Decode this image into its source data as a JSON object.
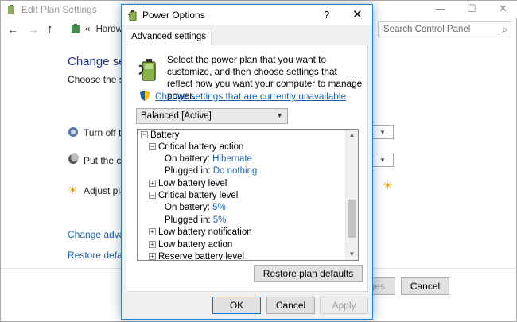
{
  "background": {
    "title": "Edit Plan Settings",
    "controls": {
      "minimize": "—",
      "maximize": "☐",
      "close": "✕"
    },
    "nav": {
      "back": "←",
      "forward": "→",
      "up": "↑",
      "chevrons": "«",
      "address": "Hardwa"
    },
    "search": {
      "placeholder": "Search Control Panel"
    },
    "heading": "Change setti",
    "subtext": "Choose the slee",
    "rows": [
      "Turn off the",
      "Put the con",
      "Adjust plan"
    ],
    "links": [
      "Change advance",
      "Restore default"
    ],
    "footer_buttons": {
      "save": "ges",
      "cancel": "Cancel"
    }
  },
  "dialog": {
    "title": "Power Options",
    "help": "?",
    "close": "✕",
    "tab": "Advanced settings",
    "intro": "Select the power plan that you want to customize, and then choose settings that reflect how you want your computer to manage power.",
    "change_link": "Change settings that are currently unavailable",
    "plan_select": "Balanced [Active]",
    "tree": [
      {
        "label": "Battery",
        "expander": "⊟"
      },
      {
        "label": "Critical battery action",
        "expander": "⊟"
      },
      {
        "label": "On battery:",
        "value": "Hibernate"
      },
      {
        "label": "Plugged in:",
        "value": "Do nothing"
      },
      {
        "label": "Low battery level",
        "expander": "⊞"
      },
      {
        "label": "Critical battery level",
        "expander": "⊟"
      },
      {
        "label": "On battery:",
        "value": "5%"
      },
      {
        "label": "Plugged in:",
        "value": "5%"
      },
      {
        "label": "Low battery notification",
        "expander": "⊞"
      },
      {
        "label": "Low battery action",
        "expander": "⊞"
      },
      {
        "label": "Reserve battery level",
        "expander": "⊞"
      }
    ],
    "restore_button": "Restore plan defaults",
    "buttons": {
      "ok": "OK",
      "cancel": "Cancel",
      "apply": "Apply"
    }
  },
  "colors": {
    "link": "#1a5fb4",
    "heading": "#1e3287",
    "accent": "#0078d7"
  }
}
